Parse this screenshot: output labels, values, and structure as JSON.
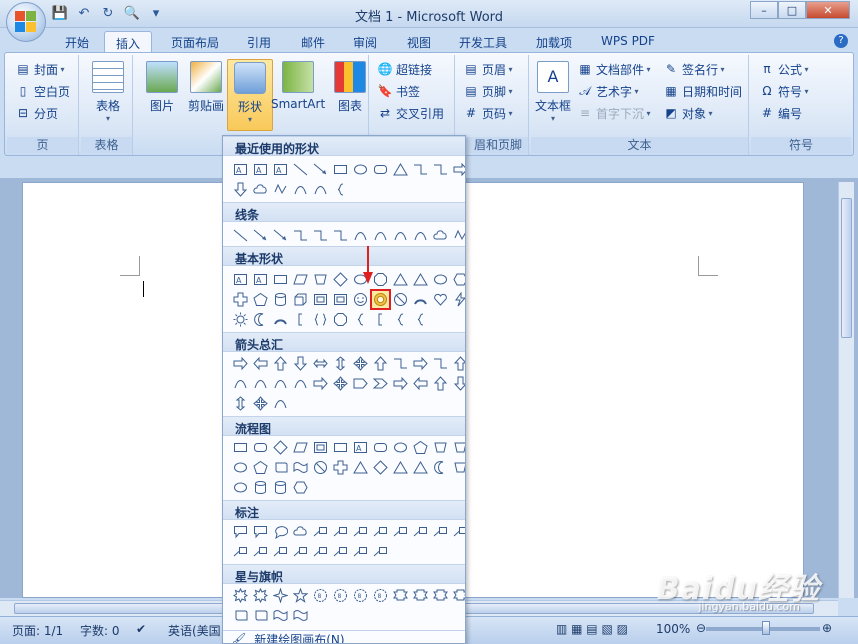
{
  "window": {
    "title": "文档 1 - Microsoft Word"
  },
  "tabs": [
    {
      "label": "开始"
    },
    {
      "label": "插入",
      "active": true
    },
    {
      "label": "页面布局"
    },
    {
      "label": "引用"
    },
    {
      "label": "邮件"
    },
    {
      "label": "审阅"
    },
    {
      "label": "视图"
    },
    {
      "label": "开发工具"
    },
    {
      "label": "加载项"
    },
    {
      "label": "WPS PDF"
    }
  ],
  "ribbon": {
    "pages": {
      "label": "页",
      "items": [
        "封面",
        "空白页",
        "分页"
      ]
    },
    "table": {
      "label": "表格",
      "button": "表格"
    },
    "illustrations": {
      "buttons": [
        "图片",
        "剪贴画",
        "形状",
        "SmartArt",
        "图表"
      ]
    },
    "links": {
      "items": [
        "超链接",
        "书签",
        "交叉引用"
      ]
    },
    "header_footer": {
      "label": "页眉和页脚",
      "visible_label": "眉和页脚",
      "items": [
        "页眉",
        "页脚",
        "页码"
      ]
    },
    "text": {
      "label": "文本",
      "textbox": "文本框",
      "items": [
        "文档部件",
        "艺术字",
        "首字下沉",
        "签名行",
        "日期和时间",
        "对象"
      ]
    },
    "symbols": {
      "label": "符号",
      "items": [
        "公式",
        "符号",
        "编号"
      ]
    }
  },
  "shapes_menu": {
    "sections": [
      "最近使用的形状",
      "线条",
      "基本形状",
      "箭头总汇",
      "流程图",
      "标注",
      "星与旗帜"
    ],
    "new_canvas": "新建绘图画布(N)",
    "highlighted_shape": "donut-shape"
  },
  "status": {
    "page": "页面: 1/1",
    "words": "字数: 0",
    "language": "英语(美国",
    "zoom": "100%"
  },
  "watermark": {
    "text": "Baidu经验",
    "sub": "jingyan.baidu.com"
  },
  "colors": {
    "accent": "#15428b",
    "highlight_border": "#e02020",
    "active_button": "#f9c95a"
  }
}
